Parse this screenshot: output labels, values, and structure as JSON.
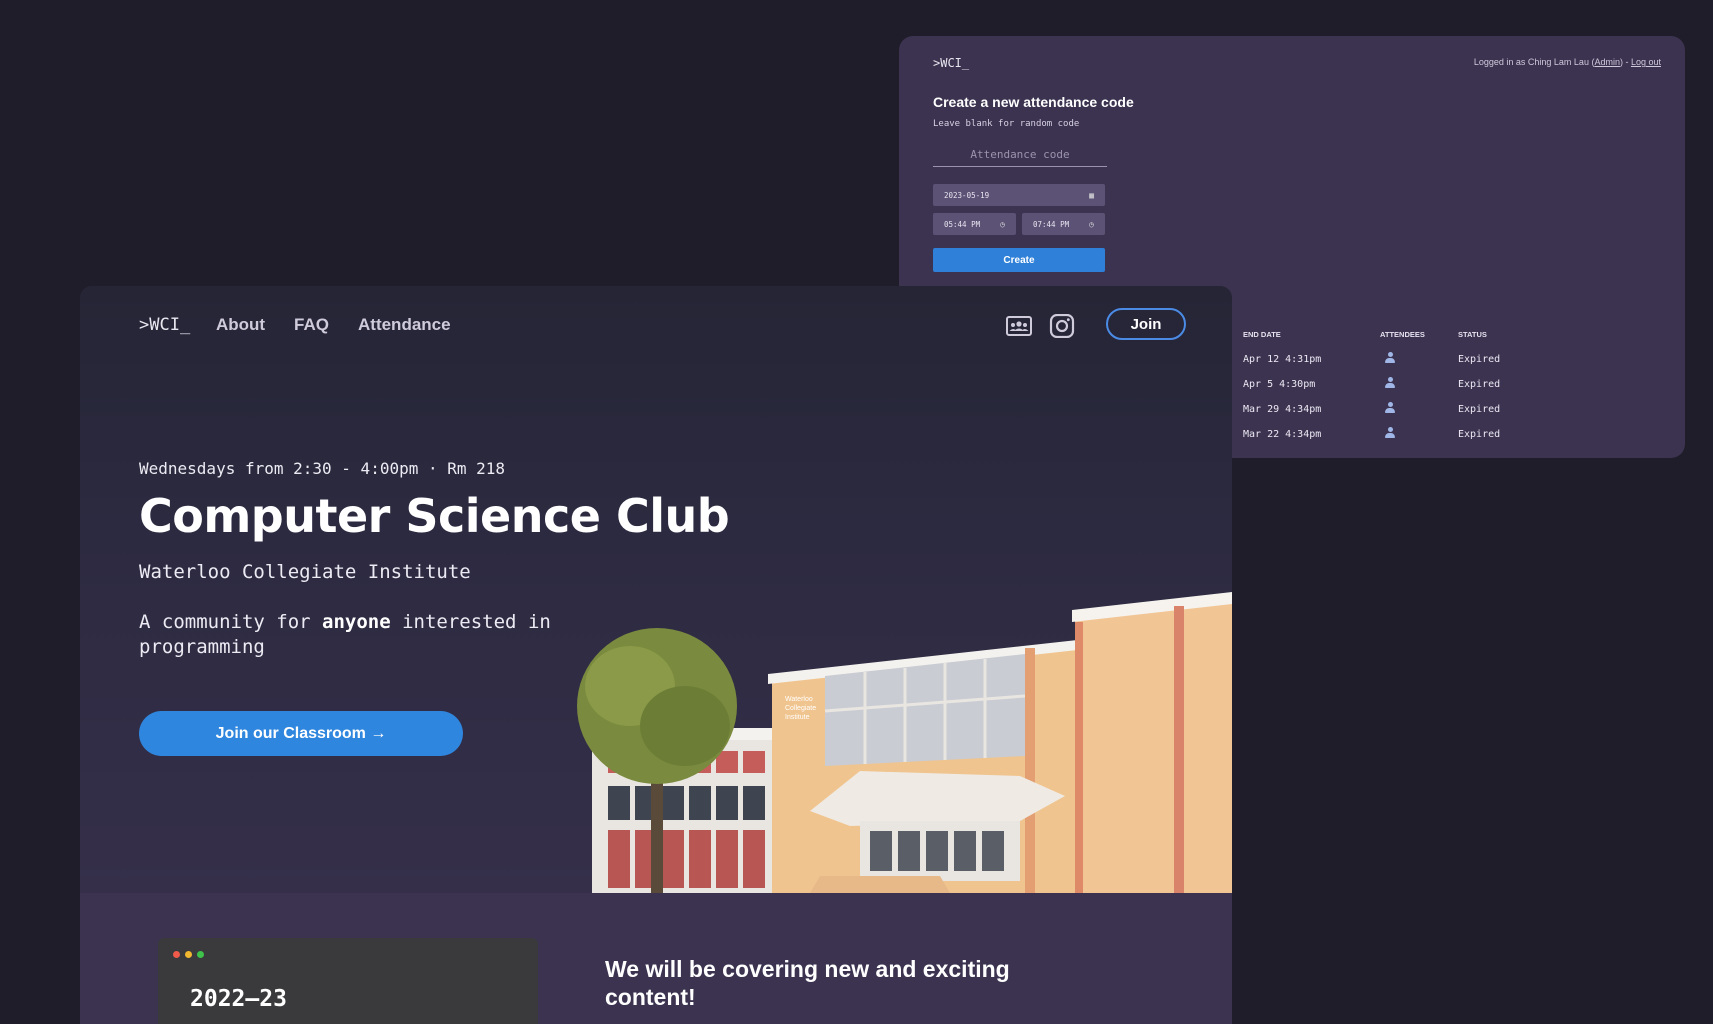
{
  "admin": {
    "brand": ">WCI_",
    "login_prefix": "Logged in as Ching Lam Lau (",
    "login_role": "Admin",
    "login_mid": ") - ",
    "logout": "Log out",
    "form_title": "Create a new attendance code",
    "form_hint": "Leave blank for random code",
    "code_placeholder": "Attendance code",
    "date_value": "2023-05-19",
    "start_time": "05:44 PM",
    "end_time": "07:44 PM",
    "create_label": "Create",
    "table": {
      "headers": [
        "END DATE",
        "ATTENDEES",
        "STATUS"
      ],
      "rows": [
        {
          "end": "Apr 12 4:31pm",
          "status": "Expired"
        },
        {
          "end": "Apr 5 4:30pm",
          "status": "Expired"
        },
        {
          "end": "Mar 29 4:34pm",
          "status": "Expired"
        },
        {
          "end": "Mar 22 4:34pm",
          "status": "Expired"
        }
      ]
    }
  },
  "main": {
    "nav": {
      "brand": ">WCI_",
      "links": [
        "About",
        "FAQ",
        "Attendance"
      ],
      "icons": [
        "classroom-icon",
        "instagram-icon"
      ],
      "join_label": "Join"
    },
    "hero": {
      "schedule": "Wednesdays from 2:30 - 4:00pm · Rm 218",
      "title": "Computer Science Club",
      "subtitle": "Waterloo Collegiate Institute",
      "tagline_pre": "A community for ",
      "tagline_bold": "anyone",
      "tagline_post": " interested in programming",
      "cta_label": "Join our Classroom →",
      "building_sign": [
        "Waterloo",
        "Collegiate",
        "Institute"
      ]
    },
    "lower": {
      "terminal_text": "2022–23",
      "heading": "We will be covering new and exciting content!"
    }
  },
  "colors": {
    "page_bg": "#1f1d2a",
    "panel_bg": "#3c3350",
    "accent": "#2f86de",
    "dot_red": "#ef5a4a",
    "dot_yellow": "#f2b731",
    "dot_green": "#3fc24a"
  }
}
